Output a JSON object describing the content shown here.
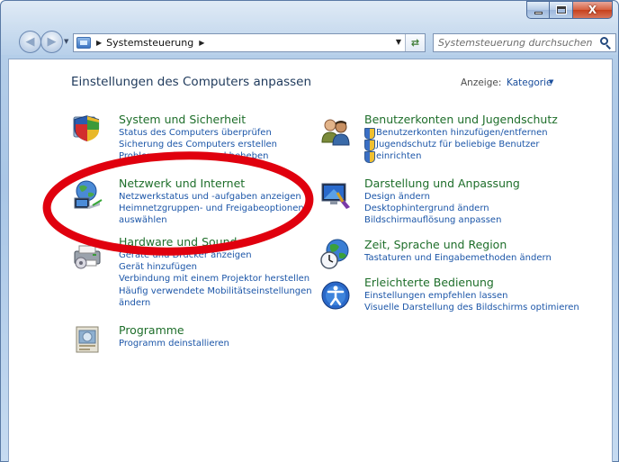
{
  "window": {
    "caption_close": "X"
  },
  "navbar": {
    "breadcrumb": "Systemsteuerung",
    "search_placeholder": "Systemsteuerung durchsuchen"
  },
  "content": {
    "title": "Einstellungen des Computers anpassen",
    "view_label": "Anzeige:",
    "view_value": "Kategorie"
  },
  "categories": [
    {
      "heading": "System und Sicherheit",
      "icon": "shield-icon",
      "links": [
        "Status des Computers überprüfen",
        "Sicherung des Computers erstellen",
        "Probleme erkennen und beheben"
      ]
    },
    {
      "heading": "Netzwerk und Internet",
      "icon": "network-globe-icon",
      "links": [
        "Netzwerkstatus und -aufgaben anzeigen",
        "Heimnetzgruppen- und Freigabeoptionen",
        "auswählen"
      ]
    },
    {
      "heading": "Hardware und Sound",
      "icon": "printer-icon",
      "links": [
        "Geräte und Drucker anzeigen",
        "Gerät hinzufügen",
        "Verbindung mit einem Projektor herstellen",
        "Häufig verwendete Mobilitätseinstellungen",
        "ändern"
      ]
    },
    {
      "heading": "Programme",
      "icon": "programs-icon",
      "links": [
        "Programm deinstallieren"
      ]
    },
    {
      "heading": "Benutzerkonten und Jugendschutz",
      "icon": "users-icon",
      "links": [
        "Benutzerkonten hinzufügen/entfernen",
        "Jugendschutz für beliebige Benutzer",
        "einrichten"
      ]
    },
    {
      "heading": "Darstellung und Anpassung",
      "icon": "display-icon",
      "links": [
        "Design ändern",
        "Desktophintergrund ändern",
        "Bildschirmauflösung anpassen"
      ]
    },
    {
      "heading": "Zeit, Sprache und Region",
      "icon": "globe-clock-icon",
      "links": [
        "Tastaturen und Eingabemethoden ändern"
      ]
    },
    {
      "heading": "Erleichterte Bedienung",
      "icon": "accessibility-icon",
      "links": [
        "Einstellungen empfehlen lassen",
        "Visuelle Darstellung des Bildschirms optimieren"
      ]
    }
  ],
  "colors": {
    "heading": "#1e6e2a",
    "link": "#1c56a8",
    "annotation": "#e0000e"
  }
}
